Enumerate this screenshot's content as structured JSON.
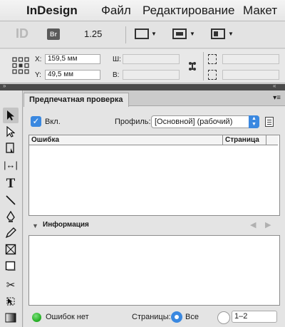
{
  "menubar": {
    "app_name": "InDesign",
    "items": [
      "Файл",
      "Редактирование",
      "Макет"
    ]
  },
  "appbar": {
    "zoom": "1.25"
  },
  "control_panel": {
    "x_label": "X:",
    "x_value": "159,5 мм",
    "y_label": "Y:",
    "y_value": "49,5 мм",
    "w_label": "Ш:",
    "h_label": "В:"
  },
  "preflight": {
    "tab_title": "Предпечатная проверка",
    "enable_label": "Вкл.",
    "enabled": true,
    "profile_label": "Профиль:",
    "profile_value": "[Основной] (рабочий)",
    "col_error": "Ошибка",
    "col_page": "Страница",
    "info_label": "Информация",
    "status_text": "Ошибок нет",
    "pages_label": "Страницы:",
    "pages_all": "Все",
    "pages_range": "1–2"
  },
  "colors": {
    "accent": "#2f7ed8",
    "ok_green": "#2bb42b",
    "dark_strip": "#4a4a4a"
  }
}
